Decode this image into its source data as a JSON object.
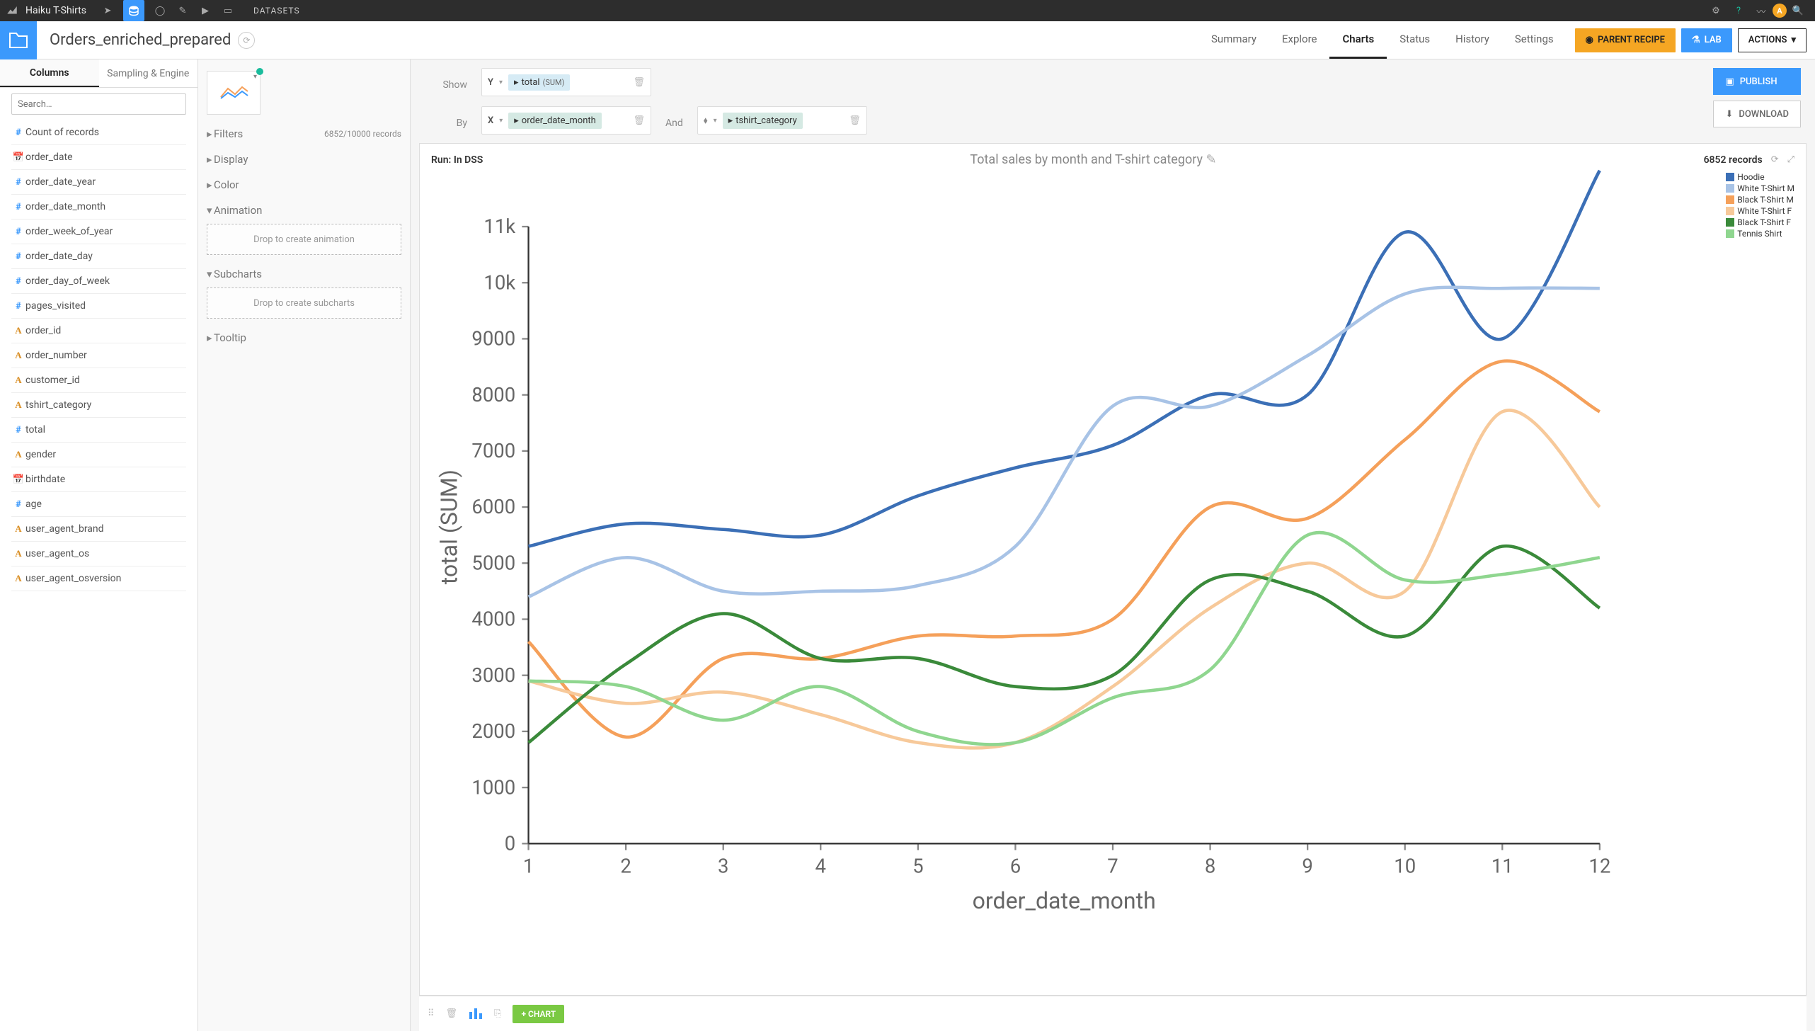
{
  "topbar": {
    "project": "Haiku T-Shirts",
    "section": "DATASETS",
    "avatar": "A"
  },
  "header": {
    "name": "Orders_enriched_prepared",
    "tabs": [
      "Summary",
      "Explore",
      "Charts",
      "Status",
      "History",
      "Settings"
    ],
    "active_tab": "Charts",
    "parent_recipe": "PARENT RECIPE",
    "lab": "LAB",
    "actions": "ACTIONS"
  },
  "sidebar": {
    "tabs": [
      "Columns",
      "Sampling & Engine"
    ],
    "active": "Columns",
    "search_placeholder": "Search…",
    "columns": [
      {
        "type": "hash",
        "name": "Count of records"
      },
      {
        "type": "cal",
        "name": "order_date"
      },
      {
        "type": "hash",
        "name": "order_date_year"
      },
      {
        "type": "hash",
        "name": "order_date_month"
      },
      {
        "type": "hash",
        "name": "order_week_of_year"
      },
      {
        "type": "hash",
        "name": "order_date_day"
      },
      {
        "type": "hash",
        "name": "order_day_of_week"
      },
      {
        "type": "hash",
        "name": "pages_visited"
      },
      {
        "type": "A",
        "name": "order_id"
      },
      {
        "type": "A",
        "name": "order_number"
      },
      {
        "type": "A",
        "name": "customer_id"
      },
      {
        "type": "A",
        "name": "tshirt_category"
      },
      {
        "type": "hash",
        "name": "total"
      },
      {
        "type": "A",
        "name": "gender"
      },
      {
        "type": "cal",
        "name": "birthdate"
      },
      {
        "type": "hash",
        "name": "age"
      },
      {
        "type": "A",
        "name": "user_agent_brand"
      },
      {
        "type": "A",
        "name": "user_agent_os"
      },
      {
        "type": "A",
        "name": "user_agent_osversion"
      }
    ]
  },
  "config": {
    "filters": {
      "label": "Filters",
      "records": "6852/10000 records"
    },
    "display": "Display",
    "color": "Color",
    "animation": {
      "label": "Animation",
      "drop": "Drop to create animation"
    },
    "subcharts": {
      "label": "Subcharts",
      "drop": "Drop to create subcharts"
    },
    "tooltip": "Tooltip"
  },
  "controls": {
    "show_label": "Show",
    "y_axis": "Y",
    "y_value": "total",
    "y_agg": "(SUM)",
    "by_label": "By",
    "x_axis": "X",
    "x_value": "order_date_month",
    "and_label": "And",
    "and_value": "tshirt_category",
    "publish": "PUBLISH",
    "download": "DOWNLOAD"
  },
  "chart": {
    "run": "Run: In DSS",
    "title": "Total sales by month and T-shirt category",
    "records": "6852 records",
    "add_chart": "+ CHART",
    "xlabel": "order_date_month",
    "ylabel": "total (SUM)"
  },
  "chart_data": {
    "type": "line",
    "xlabel": "order_date_month",
    "ylabel": "total (SUM)",
    "x": [
      1,
      2,
      3,
      4,
      5,
      6,
      7,
      8,
      9,
      10,
      11,
      12
    ],
    "ylim": [
      0,
      11000
    ],
    "yticks": [
      0,
      1000,
      2000,
      3000,
      4000,
      5000,
      6000,
      7000,
      8000,
      9000,
      10000,
      11000
    ],
    "series": [
      {
        "name": "Hoodie",
        "color": "#3b6fb6",
        "values": [
          5300,
          5700,
          5600,
          5500,
          6200,
          6700,
          7100,
          8000,
          8000,
          10900,
          9000,
          12000
        ]
      },
      {
        "name": "White T-Shirt M",
        "color": "#a8c3e6",
        "values": [
          4400,
          5100,
          4500,
          4500,
          4600,
          5300,
          7800,
          7800,
          8700,
          9800,
          9900,
          9900
        ]
      },
      {
        "name": "Black T-Shirt M",
        "color": "#f5a05a",
        "values": [
          3600,
          1900,
          3300,
          3300,
          3700,
          3700,
          4000,
          6000,
          5800,
          7200,
          8600,
          7700
        ]
      },
      {
        "name": "White T-Shirt F",
        "color": "#f7c99a",
        "values": [
          2900,
          2500,
          2700,
          2300,
          1800,
          1800,
          2800,
          4200,
          5000,
          4500,
          7700,
          6000
        ]
      },
      {
        "name": "Black T-Shirt F",
        "color": "#3a8a3a",
        "values": [
          1800,
          3200,
          4100,
          3300,
          3300,
          2800,
          3000,
          4700,
          4500,
          3700,
          5300,
          4200
        ]
      },
      {
        "name": "Tennis Shirt",
        "color": "#8fd68f",
        "values": [
          2900,
          2800,
          2200,
          2800,
          2000,
          1800,
          2600,
          3100,
          5500,
          4700,
          4800,
          5100
        ]
      }
    ]
  }
}
